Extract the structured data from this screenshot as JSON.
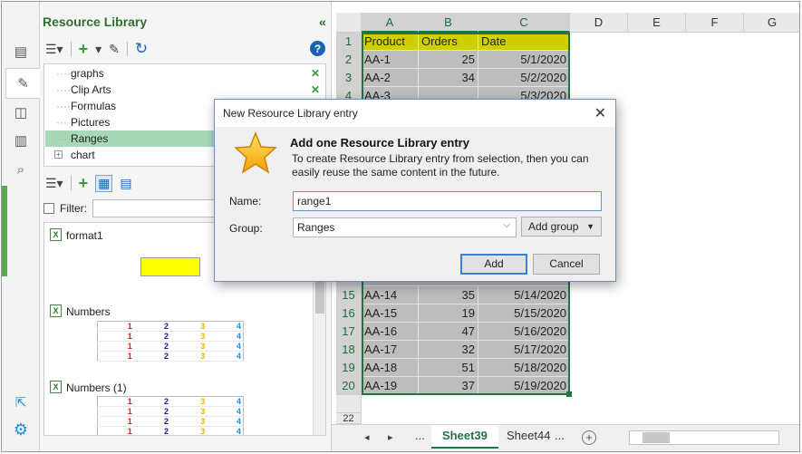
{
  "pane": {
    "title": "Resource Library",
    "collapse_glyph": "«",
    "help_glyph": "?",
    "tree_items": [
      {
        "label": "graphs",
        "has_delete": true
      },
      {
        "label": "Clip Arts",
        "has_delete": true
      },
      {
        "label": "Formulas",
        "has_delete": false
      },
      {
        "label": "Pictures",
        "has_delete": false
      },
      {
        "label": "Ranges",
        "has_delete": false,
        "selected": true
      },
      {
        "label": "chart",
        "has_delete": false,
        "expandable": true
      }
    ],
    "delete_glyph": "✕",
    "filter_label": "Filter:",
    "gallery": {
      "format_label": "format1",
      "numbers_label": "Numbers",
      "numbers1_label": "Numbers (1)",
      "numbers_values": [
        "1",
        "2",
        "3",
        "4"
      ]
    },
    "icons": [
      "menu-icon",
      "add-icon",
      "edit-icon",
      "refresh-icon",
      "help-icon",
      "external-link-icon",
      "settings-icon"
    ]
  },
  "sheet": {
    "columns": [
      "A",
      "B",
      "C",
      "D",
      "E",
      "F",
      "G"
    ],
    "header_row": [
      "Product",
      "Orders",
      "Date"
    ],
    "rows": [
      {
        "row": "1"
      },
      {
        "row": "2",
        "a": "AA-1",
        "b": "25",
        "c": "5/1/2020"
      },
      {
        "row": "3",
        "a": "AA-2",
        "b": "34",
        "c": "5/2/2020"
      },
      {
        "row": "4",
        "a": "AA-3",
        "b": "",
        "c": "5/3/2020"
      },
      {
        "row": "15",
        "a": "AA-14",
        "b": "35",
        "c": "5/14/2020"
      },
      {
        "row": "16",
        "a": "AA-15",
        "b": "19",
        "c": "5/15/2020"
      },
      {
        "row": "17",
        "a": "AA-16",
        "b": "47",
        "c": "5/16/2020"
      },
      {
        "row": "18",
        "a": "AA-17",
        "b": "32",
        "c": "5/17/2020"
      },
      {
        "row": "19",
        "a": "AA-18",
        "b": "51",
        "c": "5/18/2020"
      },
      {
        "row": "20",
        "a": "AA-19",
        "b": "37",
        "c": "5/19/2020"
      },
      {
        "row": "22"
      }
    ],
    "tabs": {
      "ellipsis": "...",
      "active": "Sheet39",
      "other": "Sheet44",
      "ellipsis2": "...",
      "add": "+"
    },
    "colors": {
      "header_fill": "#cfcf00",
      "data_fill": "#bdbdbd",
      "selection": "#217346"
    }
  },
  "dialog": {
    "title": "New Resource Library entry",
    "heading": "Add one Resource Library entry",
    "description": "To create Resource Library entry from selection, then you can easily reuse the same content in the future.",
    "name_label": "Name:",
    "name_value": "range1",
    "group_label": "Group:",
    "group_value": "Ranges",
    "add_group_label": "Add group",
    "add_label": "Add",
    "cancel_label": "Cancel",
    "close_glyph": "✕"
  }
}
